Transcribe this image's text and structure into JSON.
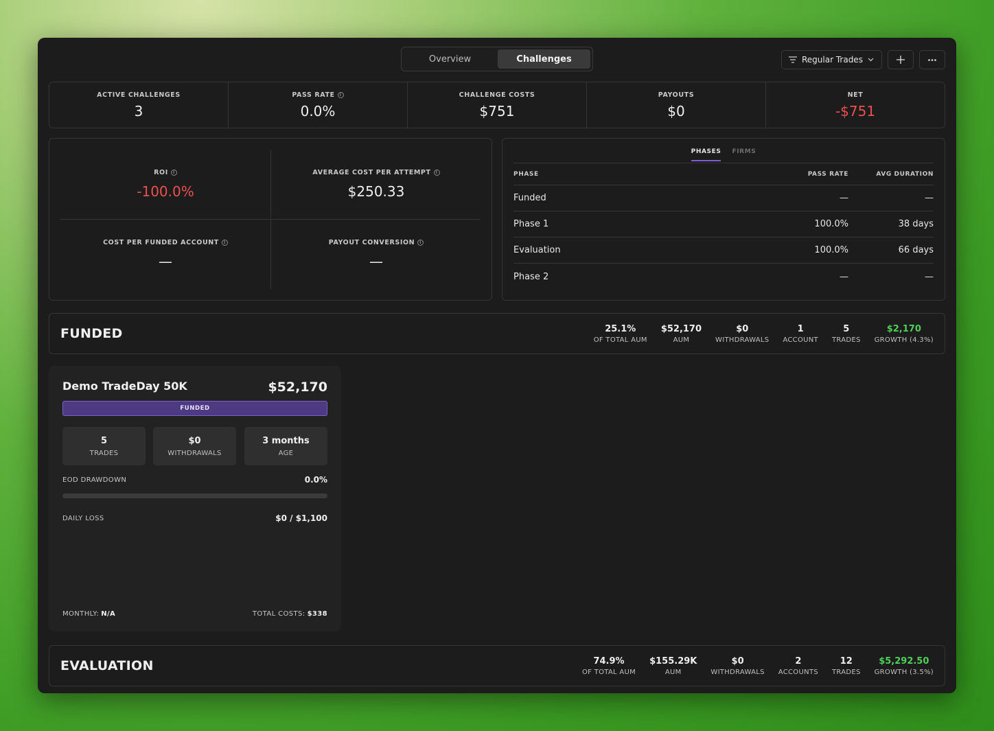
{
  "header": {
    "tabs": [
      {
        "label": "Overview",
        "active": false
      },
      {
        "label": "Challenges",
        "active": true
      }
    ],
    "filter_label": "Regular Trades",
    "add_icon": "plus-icon",
    "more_icon": "more-horizontal-icon"
  },
  "stats": {
    "active_challenges": {
      "label": "ACTIVE CHALLENGES",
      "value": "3"
    },
    "pass_rate": {
      "label": "PASS RATE",
      "value": "0.0%"
    },
    "challenge_costs": {
      "label": "CHALLENGE COSTS",
      "value": "$751"
    },
    "payouts": {
      "label": "PAYOUTS",
      "value": "$0"
    },
    "net": {
      "label": "NET",
      "value": "-$751"
    }
  },
  "metrics": {
    "roi": {
      "label": "ROI",
      "value": "-100.0%"
    },
    "avg_cost": {
      "label": "AVERAGE COST PER ATTEMPT",
      "value": "$250.33"
    },
    "cost_per_funded": {
      "label": "COST PER FUNDED ACCOUNT",
      "value": "—"
    },
    "payout_conversion": {
      "label": "PAYOUT CONVERSION",
      "value": "—"
    }
  },
  "phases": {
    "tabs": [
      {
        "label": "PHASES",
        "active": true
      },
      {
        "label": "FIRMS",
        "active": false
      }
    ],
    "headers": {
      "phase": "PHASE",
      "pass_rate": "PASS RATE",
      "avg_duration": "AVG DURATION"
    },
    "rows": [
      {
        "phase": "Funded",
        "pass_rate": "—",
        "avg_duration": "—"
      },
      {
        "phase": "Phase 1",
        "pass_rate": "100.0%",
        "avg_duration": "38 days"
      },
      {
        "phase": "Evaluation",
        "pass_rate": "100.0%",
        "avg_duration": "66 days"
      },
      {
        "phase": "Phase 2",
        "pass_rate": "—",
        "avg_duration": "—"
      }
    ]
  },
  "funded": {
    "title": "FUNDED",
    "stats": [
      {
        "value": "25.1%",
        "label": "OF TOTAL AUM"
      },
      {
        "value": "$52,170",
        "label": "AUM"
      },
      {
        "value": "$0",
        "label": "WITHDRAWALS"
      },
      {
        "value": "1",
        "label": "ACCOUNT"
      },
      {
        "value": "5",
        "label": "TRADES"
      },
      {
        "value": "$2,170",
        "label": "GROWTH (4.3%)"
      }
    ]
  },
  "card": {
    "name": "Demo TradeDay 50K",
    "balance": "$52,170",
    "badge": "FUNDED",
    "minis": [
      {
        "value": "5",
        "label": "TRADES"
      },
      {
        "value": "$0",
        "label": "WITHDRAWALS"
      },
      {
        "value": "3 months",
        "label": "AGE"
      }
    ],
    "eod_label": "EOD DRAWDOWN",
    "eod_value": "0.0%",
    "eod_fraction": 0.0,
    "daily_label": "DAILY LOSS",
    "daily_value": "$0 / $1,100",
    "monthly_label": "MONTHLY:",
    "monthly_value": "N/A",
    "total_label": "TOTAL COSTS:",
    "total_value": "$338"
  },
  "evaluation": {
    "title": "EVALUATION",
    "stats": [
      {
        "value": "74.9%",
        "label": "OF TOTAL AUM"
      },
      {
        "value": "$155.29K",
        "label": "AUM"
      },
      {
        "value": "$0",
        "label": "WITHDRAWALS"
      },
      {
        "value": "2",
        "label": "ACCOUNTS"
      },
      {
        "value": "12",
        "label": "TRADES"
      },
      {
        "value": "$5,292.50",
        "label": "GROWTH (3.5%)"
      }
    ]
  },
  "colors": {
    "negative": "#ee4f4f",
    "positive": "#4fcf5a",
    "accent": "#7b5cd6"
  }
}
